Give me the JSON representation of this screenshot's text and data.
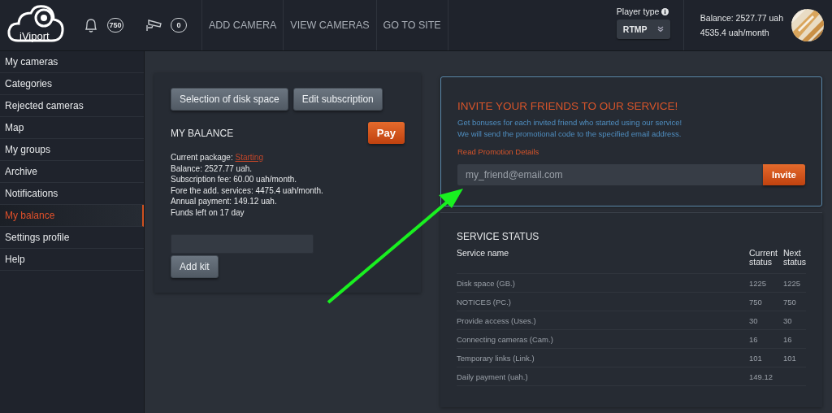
{
  "header": {
    "logo": "iViport",
    "notifications": {
      "count": "750"
    },
    "cameras": {
      "count": "0"
    },
    "nav": [
      {
        "label": "ADD CAMERA"
      },
      {
        "label": "VIEW CAMERAS"
      },
      {
        "label": "GO TO SITE"
      }
    ],
    "player_type": {
      "label": "Player type",
      "value": "RTMP"
    },
    "balance": {
      "line_1": "Balance: 2527.77 uah",
      "line_2": "4535.4 uah/month"
    }
  },
  "sidebar": {
    "items": [
      {
        "label": "My cameras",
        "selected": false
      },
      {
        "label": "Categories",
        "selected": false
      },
      {
        "label": "Rejected cameras",
        "selected": false
      },
      {
        "label": "Map",
        "selected": false
      },
      {
        "label": "My groups",
        "selected": false
      },
      {
        "label": "Archive",
        "selected": false
      },
      {
        "label": "Notifications",
        "selected": false
      },
      {
        "label": "My balance",
        "selected": true
      },
      {
        "label": "Settings profile",
        "selected": false
      },
      {
        "label": "Help",
        "selected": false
      }
    ]
  },
  "balance_card": {
    "buttons": [
      "Selection of disk space",
      "Edit subscription"
    ],
    "title": "MY BALANCE",
    "pay_button": "Pay",
    "package_label": "Current package:",
    "package_link": "Starting",
    "lines": [
      "Balance: 2527.77 uah.",
      "Subscription fee: 60.00 uah/month.",
      "Fore the add. services: 4475.4 uah/month.",
      "Annual payment: 149.12 uah.",
      "Funds left on 17 day"
    ],
    "add_kit_button": "Add kit"
  },
  "invite": {
    "title": "INVITE YOUR FRIENDS TO OUR SERVICE!",
    "text": [
      "Get bonuses for each invited friend who started using our service!",
      "We will send the promotional code to the specified email address."
    ],
    "details_link": "Read Promotion Details",
    "email": {
      "placeholder": "my_friend@email.com"
    },
    "button": "Invite"
  },
  "service_status": {
    "title": "SERVICE STATUS",
    "columns": [
      "Service name",
      "Current status",
      "Next status"
    ],
    "rows": [
      {
        "name": "Disk space (GB.)",
        "current": "1225",
        "next": "1225"
      },
      {
        "name": "NOTICES (PC.)",
        "current": "750",
        "next": "750"
      },
      {
        "name": "Provide access (Uses.)",
        "current": "30",
        "next": "30"
      },
      {
        "name": "Connecting cameras (Cam.)",
        "current": "16",
        "next": "16"
      },
      {
        "name": "Temporary links (Link.)",
        "current": "101",
        "next": "101"
      },
      {
        "name": "Daily payment (uah.)",
        "current": "149.12"
      }
    ]
  }
}
